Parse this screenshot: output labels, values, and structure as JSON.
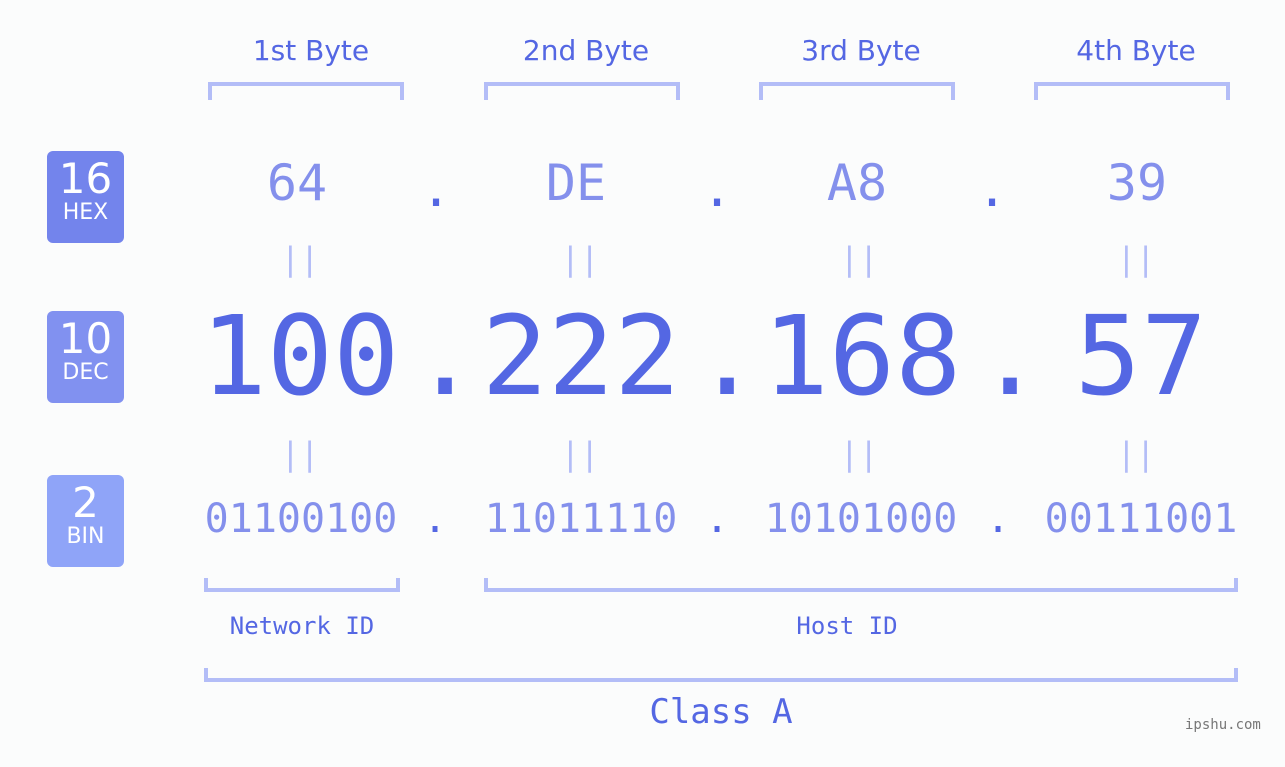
{
  "bytes": [
    {
      "label": "1st Byte",
      "hex": "64",
      "dec": "100",
      "bin": "01100100"
    },
    {
      "label": "2nd Byte",
      "hex": "DE",
      "dec": "222",
      "bin": "11011110"
    },
    {
      "label": "3rd Byte",
      "hex": "A8",
      "dec": "168",
      "bin": "10101000"
    },
    {
      "label": "4th Byte",
      "hex": "39",
      "dec": "57",
      "bin": "00111001"
    }
  ],
  "separator": ".",
  "equals": "||",
  "bases": [
    {
      "num": "16",
      "name": "HEX",
      "color": "#7384ec"
    },
    {
      "num": "10",
      "name": "DEC",
      "color": "#8191f0"
    },
    {
      "num": "2",
      "name": "BIN",
      "color": "#8fa4f8"
    }
  ],
  "network_id_label": "Network ID",
  "host_id_label": "Host ID",
  "class_label": "Class A",
  "watermark": "ipshu.com"
}
